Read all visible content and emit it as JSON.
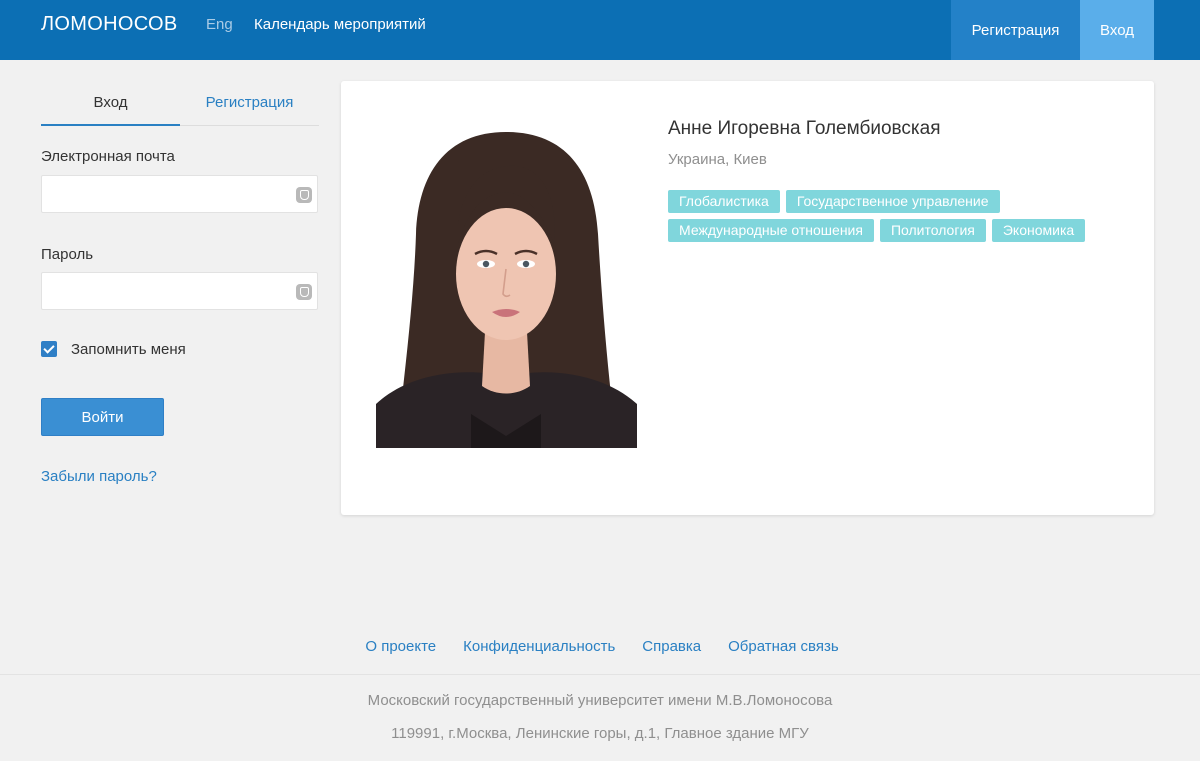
{
  "navbar": {
    "brand": "ЛОМОНОСОВ",
    "lang": "Eng",
    "calendar": "Календарь мероприятий",
    "register": "Регистрация",
    "login": "Вход"
  },
  "sidebar": {
    "tabs": [
      {
        "label": "Вход"
      },
      {
        "label": "Регистрация"
      }
    ],
    "email_label": "Электронная почта",
    "email_value": "",
    "password_label": "Пароль",
    "password_value": "",
    "remember_label": "Запомнить меня",
    "remember_checked": true,
    "submit_label": "Войти",
    "forgot_label": "Забыли пароль?"
  },
  "profile": {
    "name": "Анне Игоревна Голембиовская",
    "location": "Украина, Киев",
    "tags": [
      "Глобалистика",
      "Государственное управление",
      "Международные отношения",
      "Политология",
      "Экономика"
    ]
  },
  "footer": {
    "links": [
      "О проекте",
      "Конфиденциальность",
      "Справка",
      "Обратная связь"
    ],
    "line1": "Московский государственный университет имени М.В.Ломоносова",
    "line2": "119991, г.Москва, Ленинские горы, д.1, Главное здание МГУ"
  },
  "colors": {
    "navbar": "#0c6fb4",
    "accent": "#2a80c3",
    "tag": "#80d6dc"
  }
}
